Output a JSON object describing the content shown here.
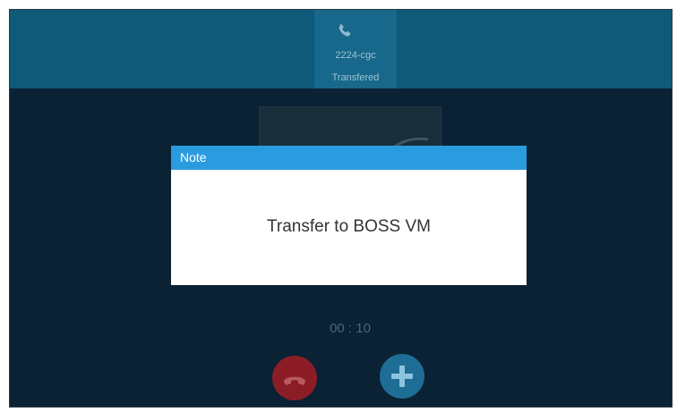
{
  "header": {
    "icon": "phone-icon",
    "contact_name": "2224-cgc",
    "status": "Transfered"
  },
  "dialog": {
    "title": "Note",
    "message": "Transfer to BOSS VM"
  },
  "call": {
    "timer": "00 : 10"
  },
  "controls": {
    "end_call_icon": "hang-up-icon",
    "add_icon": "plus-icon"
  },
  "colors": {
    "header_bg": "#0f5a78",
    "screen_bg": "#0a2233",
    "dialog_header": "#2b9be0",
    "end_call": "#8c1d26",
    "add_call": "#1d6d94"
  }
}
